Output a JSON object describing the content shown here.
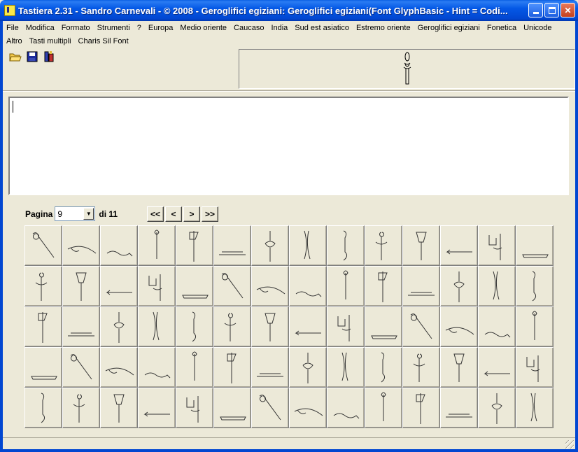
{
  "window": {
    "title": "Tastiera 2.31 - Sandro Carnevali - ©  2008 - Geroglifici egiziani: Geroglifici egiziani(Font GlyphBasic - Hint = Codi..."
  },
  "menu": {
    "row1": [
      "File",
      "Modifica",
      "Formato",
      "Strumenti",
      "?",
      "Europa",
      "Medio oriente",
      "Caucaso",
      "India",
      "Sud est asiatico",
      "Estremo oriente",
      "Geroglifici egiziani",
      "Fonetica",
      "Unicode"
    ],
    "row2": [
      "Altro",
      "Tasti multipli",
      "Charis Sil Font"
    ]
  },
  "toolbar": {
    "icons": [
      "open-folder-icon",
      "save-disk-icon",
      "keyboard-tool-icon"
    ]
  },
  "editor": {
    "value": ""
  },
  "pagination": {
    "page_label": "Pagina",
    "current_page": "9",
    "of_label": "di 11",
    "first": "<<",
    "prev": "<",
    "next": ">",
    "last": ">>"
  }
}
